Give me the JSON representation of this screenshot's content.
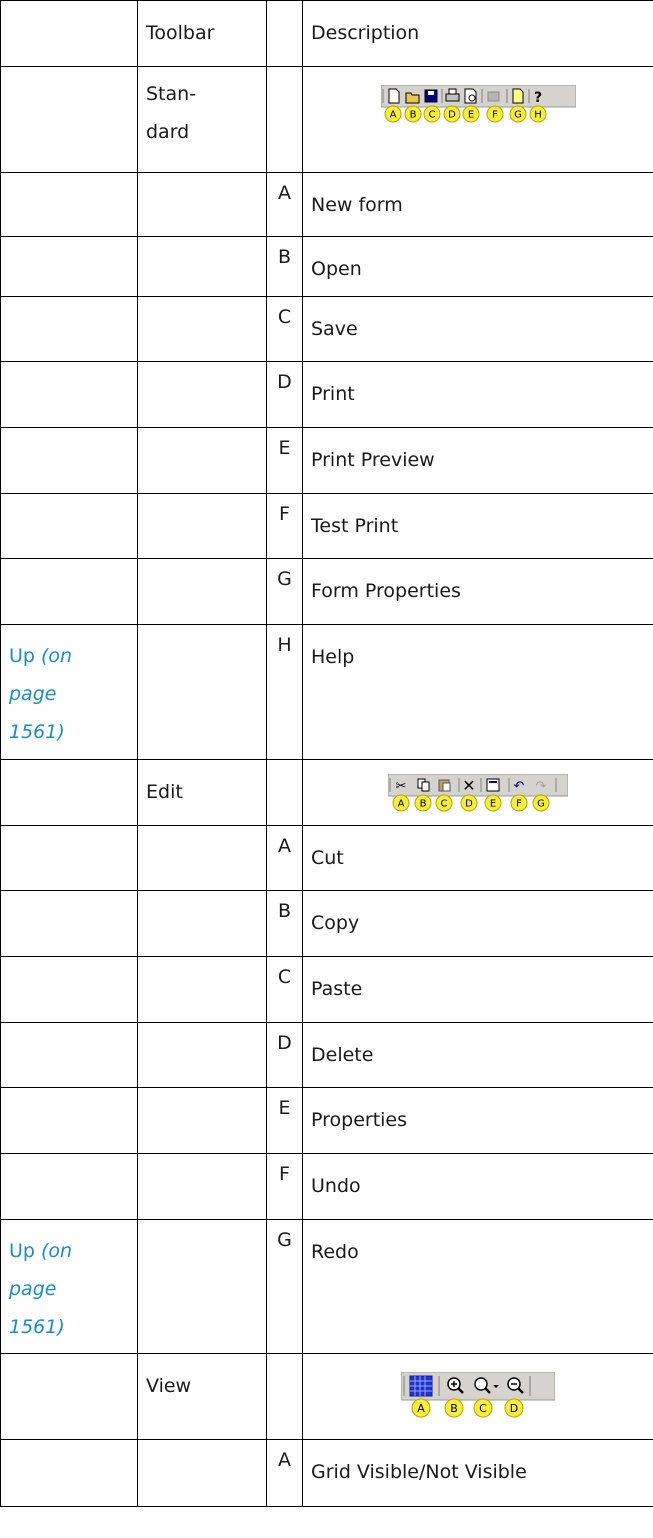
{
  "header": {
    "col1": "",
    "col2": "Toolbar",
    "col3": "",
    "col4": "Description"
  },
  "standard": {
    "name_line1": "Stan-",
    "name_line2": "dard",
    "letters": [
      "A",
      "B",
      "C",
      "D",
      "E",
      "F",
      "G",
      "H"
    ],
    "items": [
      {
        "letter": "A",
        "description": "New form"
      },
      {
        "letter": "B",
        "description": "Open"
      },
      {
        "letter": "C",
        "description": "Save"
      },
      {
        "letter": "D",
        "description": "Print"
      },
      {
        "letter": "E",
        "description": "Print Preview"
      },
      {
        "letter": "F",
        "description": "Test Print"
      },
      {
        "letter": "G",
        "description": "Form Properties"
      },
      {
        "letter": "H",
        "description": "Help"
      }
    ]
  },
  "edit": {
    "name": "Edit",
    "letters": [
      "A",
      "B",
      "C",
      "D",
      "E",
      "F",
      "G"
    ],
    "items": [
      {
        "letter": "A",
        "description": "Cut"
      },
      {
        "letter": "B",
        "description": "Copy"
      },
      {
        "letter": "C",
        "description": "Paste"
      },
      {
        "letter": "D",
        "description": "Delete"
      },
      {
        "letter": "E",
        "description": "Properties"
      },
      {
        "letter": "F",
        "description": "Undo"
      },
      {
        "letter": "G",
        "description": "Redo"
      }
    ]
  },
  "view": {
    "name": "View",
    "letters": [
      "A",
      "B",
      "C",
      "D"
    ],
    "items": [
      {
        "letter": "A",
        "description": "Grid Visible/Not Visible"
      }
    ]
  },
  "up_link": {
    "text": "Up",
    "ref_line1": "(on",
    "ref_line2": "page",
    "ref_line3": "1561)"
  },
  "colors": {
    "link": "#1e8bc3",
    "badge_fill": "#f7ee3a",
    "badge_border": "#b8a400",
    "toolbar_bg": "#d6d3ce"
  }
}
